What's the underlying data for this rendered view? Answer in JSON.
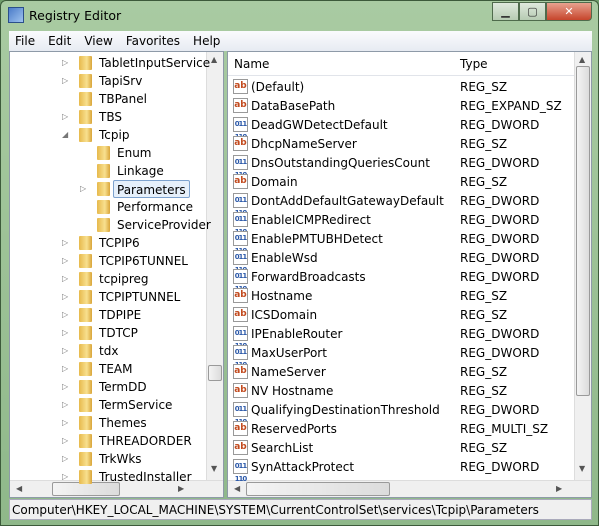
{
  "window": {
    "title": "Registry Editor",
    "controls": [
      "minimize",
      "maximize",
      "close"
    ]
  },
  "menu": [
    "File",
    "Edit",
    "View",
    "Favorites",
    "Help"
  ],
  "tree": [
    {
      "label": "TabletInputService",
      "level": 1,
      "expander": true
    },
    {
      "label": "TapiSrv",
      "level": 1,
      "expander": true
    },
    {
      "label": "TBPanel",
      "level": 1,
      "expander": false
    },
    {
      "label": "TBS",
      "level": 1,
      "expander": true
    },
    {
      "label": "Tcpip",
      "level": 1,
      "expander": "open"
    },
    {
      "label": "Enum",
      "level": 2,
      "expander": false
    },
    {
      "label": "Linkage",
      "level": 2,
      "expander": false
    },
    {
      "label": "Parameters",
      "level": 2,
      "expander": true,
      "selected": true
    },
    {
      "label": "Performance",
      "level": 2,
      "expander": false
    },
    {
      "label": "ServiceProvider",
      "level": 2,
      "expander": false
    },
    {
      "label": "TCPIP6",
      "level": 1,
      "expander": true
    },
    {
      "label": "TCPIP6TUNNEL",
      "level": 1,
      "expander": true
    },
    {
      "label": "tcpipreg",
      "level": 1,
      "expander": true
    },
    {
      "label": "TCPIPTUNNEL",
      "level": 1,
      "expander": true
    },
    {
      "label": "TDPIPE",
      "level": 1,
      "expander": true
    },
    {
      "label": "TDTCP",
      "level": 1,
      "expander": true
    },
    {
      "label": "tdx",
      "level": 1,
      "expander": true
    },
    {
      "label": "TEAM",
      "level": 1,
      "expander": true
    },
    {
      "label": "TermDD",
      "level": 1,
      "expander": true
    },
    {
      "label": "TermService",
      "level": 1,
      "expander": true
    },
    {
      "label": "Themes",
      "level": 1,
      "expander": true
    },
    {
      "label": "THREADORDER",
      "level": 1,
      "expander": true
    },
    {
      "label": "TrkWks",
      "level": 1,
      "expander": true
    },
    {
      "label": "TrustedInstaller",
      "level": 1,
      "expander": true
    }
  ],
  "list": {
    "columns": [
      "Name",
      "Type"
    ],
    "rows": [
      {
        "name": "(Default)",
        "type": "REG_SZ",
        "icon": "string-value-icon"
      },
      {
        "name": "DataBasePath",
        "type": "REG_EXPAND_SZ",
        "icon": "string-value-icon"
      },
      {
        "name": "DeadGWDetectDefault",
        "type": "REG_DWORD",
        "icon": "binary-value-icon"
      },
      {
        "name": "DhcpNameServer",
        "type": "REG_SZ",
        "icon": "string-value-icon"
      },
      {
        "name": "DnsOutstandingQueriesCount",
        "type": "REG_DWORD",
        "icon": "binary-value-icon"
      },
      {
        "name": "Domain",
        "type": "REG_SZ",
        "icon": "string-value-icon"
      },
      {
        "name": "DontAddDefaultGatewayDefault",
        "type": "REG_DWORD",
        "icon": "binary-value-icon"
      },
      {
        "name": "EnableICMPRedirect",
        "type": "REG_DWORD",
        "icon": "binary-value-icon"
      },
      {
        "name": "EnablePMTUBHDetect",
        "type": "REG_DWORD",
        "icon": "binary-value-icon"
      },
      {
        "name": "EnableWsd",
        "type": "REG_DWORD",
        "icon": "binary-value-icon"
      },
      {
        "name": "ForwardBroadcasts",
        "type": "REG_DWORD",
        "icon": "binary-value-icon"
      },
      {
        "name": "Hostname",
        "type": "REG_SZ",
        "icon": "string-value-icon"
      },
      {
        "name": "ICSDomain",
        "type": "REG_SZ",
        "icon": "string-value-icon"
      },
      {
        "name": "IPEnableRouter",
        "type": "REG_DWORD",
        "icon": "binary-value-icon"
      },
      {
        "name": "MaxUserPort",
        "type": "REG_DWORD",
        "icon": "binary-value-icon"
      },
      {
        "name": "NameServer",
        "type": "REG_SZ",
        "icon": "string-value-icon"
      },
      {
        "name": "NV Hostname",
        "type": "REG_SZ",
        "icon": "string-value-icon"
      },
      {
        "name": "QualifyingDestinationThreshold",
        "type": "REG_DWORD",
        "icon": "binary-value-icon"
      },
      {
        "name": "ReservedPorts",
        "type": "REG_MULTI_SZ",
        "icon": "string-value-icon"
      },
      {
        "name": "SearchList",
        "type": "REG_SZ",
        "icon": "string-value-icon"
      },
      {
        "name": "SynAttackProtect",
        "type": "REG_DWORD",
        "icon": "binary-value-icon"
      }
    ]
  },
  "icons": {
    "string": "ab",
    "binary": "011 110"
  },
  "status": "Computer\\HKEY_LOCAL_MACHINE\\SYSTEM\\CurrentControlSet\\services\\Tcpip\\Parameters"
}
